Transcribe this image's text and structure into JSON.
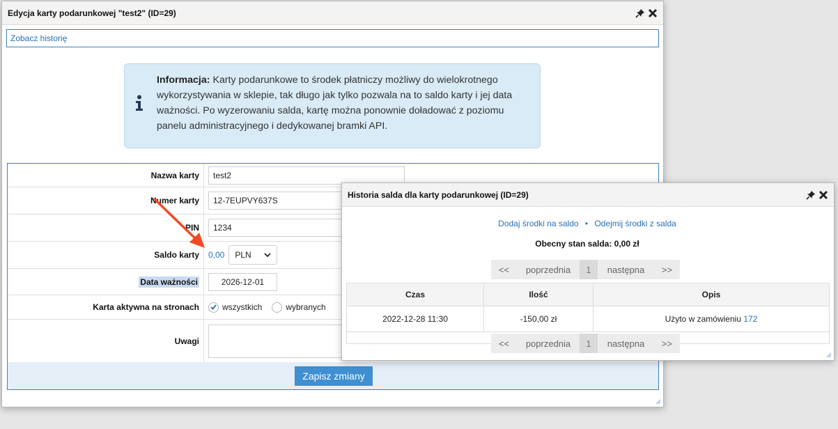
{
  "main_window": {
    "title": "Edycja karty podarunkowej \"test2\" (ID=29)",
    "history_link": "Zobacz historię",
    "info": {
      "heading": "Informacja:",
      "text": "Karty podarunkowe to środek płatniczy możliwy do wielokrotnego wykorzystywania w sklepie, tak długo jak tylko pozwala na to saldo karty i jej data ważności. Po wyzerowaniu salda, kartę można ponownie doładować z poziomu panelu administracyjnego i dedykowanej bramki API."
    },
    "form": {
      "card_name": {
        "label": "Nazwa karty",
        "value": "test2"
      },
      "card_number": {
        "label": "Numer karty",
        "value": "12-7EUPVY637S"
      },
      "pin": {
        "label": "PIN",
        "value": "1234"
      },
      "balance": {
        "label": "Saldo karty",
        "value": "0,00",
        "currency": "PLN"
      },
      "expiry": {
        "label": "Data ważności",
        "value": "2026-12-01"
      },
      "active_on": {
        "label": "Karta aktywna na stronach",
        "option_all": "wszystkich",
        "option_selected": "wybranych",
        "checked": "wszystkich"
      },
      "notes": {
        "label": "Uwagi",
        "value": ""
      },
      "submit": "Zapisz zmiany"
    }
  },
  "popup": {
    "title": "Historia salda dla karty podarunkowej (ID=29)",
    "add_funds": "Dodaj środki na saldo",
    "separator": "•",
    "subtract_funds": "Odejmij środki z salda",
    "current_balance": "Obecny stan salda: 0,00 zł",
    "pager": {
      "first": "<<",
      "prev": "poprzednia",
      "page": "1",
      "next": "następna",
      "last": ">>"
    },
    "columns": {
      "time": "Czas",
      "amount": "Ilość",
      "desc": "Opis"
    },
    "rows": [
      {
        "time": "2022-12-28 11:30",
        "amount": "-150,00 zł",
        "desc": "Użyto w zamówieniu",
        "order": "172"
      }
    ]
  },
  "colors": {
    "accent": "#3d7fc1",
    "link": "#2a6fb5",
    "info_bg": "#d9ebf7",
    "button": "#3f8fd1",
    "arrow": "#f04a24"
  },
  "icons": [
    "pin-icon",
    "close-icon",
    "info-icon",
    "chevron-down-icon",
    "check-icon",
    "resize-grip-icon",
    "arrow-annotation"
  ]
}
